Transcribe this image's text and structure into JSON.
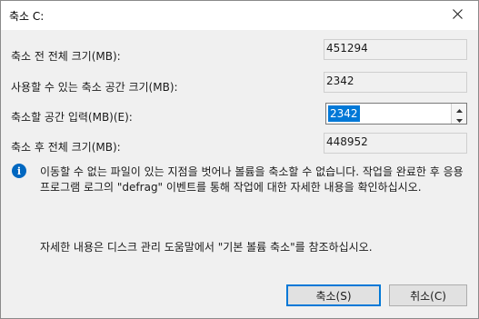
{
  "window": {
    "title": "축소 C:"
  },
  "fields": {
    "total_before_label": "축소 전 전체 크기(MB):",
    "total_before_value": "451294",
    "available_label": "사용할 수 있는 축소 공간 크기(MB):",
    "available_value": "2342",
    "shrink_amount_label": "축소할 공간 입력(MB)(E):",
    "shrink_amount_value": "2342",
    "total_after_label": "축소 후 전체 크기(MB):",
    "total_after_value": "448952"
  },
  "info": {
    "icon": "info-icon",
    "text": "이동할 수 없는 파일이 있는 지점을 벗어나 볼륨을 축소할 수 없습니다. 작업을 완료한 후 응용 프로그램 로그의 \"defrag\" 이벤트를 통해 작업에 대한 자세한 내용을 확인하십시오.",
    "help": "자세한 내용은 디스크 관리 도움말에서 \"기본 볼륨 축소\"를 참조하십시오."
  },
  "buttons": {
    "shrink": "축소(S)",
    "cancel": "취소(C)"
  },
  "colors": {
    "selection": "#0078d7",
    "info_icon": "#0067c0",
    "default_button_border": "#0078d7"
  }
}
